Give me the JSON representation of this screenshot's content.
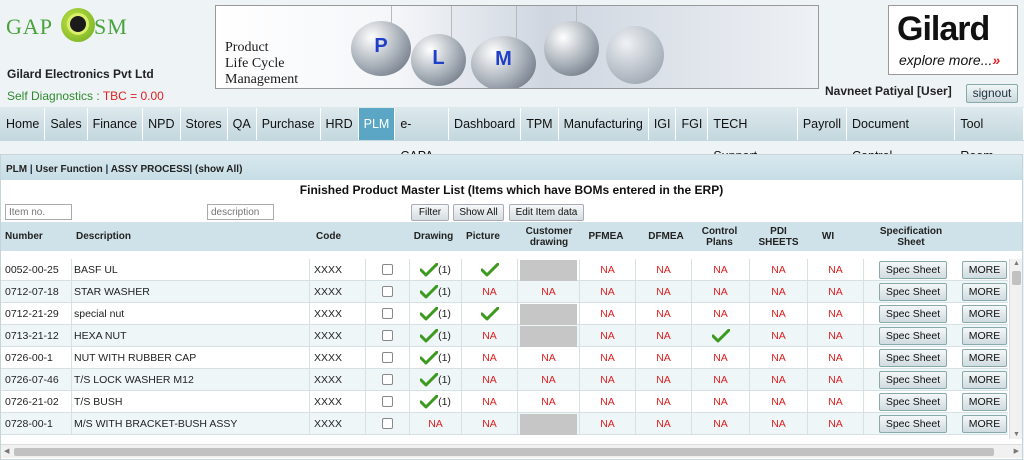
{
  "header": {
    "logo_left_1": "GAP",
    "logo_left_2": "SM",
    "company": "Gilard Electronics Pvt Ltd",
    "self_diag_label": "Self Diagnostics : ",
    "self_diag_value": "TBC = 0.00",
    "banner_text": [
      "Product",
      "Life Cycle",
      "Management"
    ],
    "banner_letters": [
      "P",
      "L",
      "M"
    ],
    "brand": "Gilard",
    "brand_tagline": "explore more...",
    "brand_arrow": "»",
    "user": "Navneet Patiyal [User]",
    "signout_label": "signout"
  },
  "nav": {
    "items": [
      "Home",
      "Sales",
      "Finance",
      "NPD",
      "Stores",
      "QA",
      "Purchase",
      "HRD",
      "PLM",
      "e-CAPA",
      "Dashboard",
      "TPM",
      "Manufacturing",
      "IGI",
      "FGI",
      "TECH Support",
      "Payroll",
      "Document Control",
      "Tool Room"
    ],
    "active": "PLM"
  },
  "breadcrumb": [
    "PLM",
    "User Function",
    "ASSY PROCESS",
    "(show All)"
  ],
  "page_title": "Finished Product Master List (Items which have BOMs entered in the ERP)",
  "filters": {
    "item_placeholder": "Item no.",
    "desc_placeholder": "description",
    "filter_label": "Filter",
    "show_all_label": "Show All",
    "edit_label": "Edit Item data"
  },
  "columns": [
    "Number",
    "Description",
    "Code",
    "",
    "Drawing",
    "Picture",
    "Customer drawing",
    "PFMEA",
    "DFMEA",
    "Control Plans",
    "PDI SHEETS",
    "WI",
    "Specification Sheet"
  ],
  "rows": [
    {
      "number": "0052-00-25",
      "description": "BASF UL",
      "code": "XXXX",
      "drawing": "(1)",
      "picture": "tick",
      "customer": "gray",
      "pfmea": "NA",
      "dfmea": "NA",
      "control": "NA",
      "pdi": "NA",
      "wi": "NA"
    },
    {
      "number": "0712-07-18",
      "description": "STAR WASHER",
      "code": "XXXX",
      "drawing": "(1)",
      "picture": "NA",
      "customer": "NA",
      "pfmea": "NA",
      "dfmea": "NA",
      "control": "NA",
      "pdi": "NA",
      "wi": "NA"
    },
    {
      "number": "0712-21-29",
      "description": "special nut",
      "code": "XXXX",
      "drawing": "(1)",
      "picture": "tick",
      "customer": "gray",
      "pfmea": "NA",
      "dfmea": "NA",
      "control": "NA",
      "pdi": "NA",
      "wi": "NA"
    },
    {
      "number": "0713-21-12",
      "description": "HEXA NUT",
      "code": "XXXX",
      "drawing": "(1)",
      "picture": "NA",
      "customer": "gray",
      "pfmea": "NA",
      "dfmea": "NA",
      "control": "tick",
      "pdi": "NA",
      "wi": "NA"
    },
    {
      "number": "0726-00-1",
      "description": "NUT WITH RUBBER CAP",
      "code": "XXXX",
      "drawing": "(1)",
      "picture": "NA",
      "customer": "NA",
      "pfmea": "NA",
      "dfmea": "NA",
      "control": "NA",
      "pdi": "NA",
      "wi": "NA"
    },
    {
      "number": "0726-07-46",
      "description": "T/S LOCK WASHER M12",
      "code": "XXXX",
      "drawing": "(1)",
      "picture": "NA",
      "customer": "NA",
      "pfmea": "NA",
      "dfmea": "NA",
      "control": "NA",
      "pdi": "NA",
      "wi": "NA"
    },
    {
      "number": "0726-21-02",
      "description": "T/S BUSH",
      "code": "XXXX",
      "drawing": "(1)",
      "picture": "NA",
      "customer": "NA",
      "pfmea": "NA",
      "dfmea": "NA",
      "control": "NA",
      "pdi": "NA",
      "wi": "NA"
    },
    {
      "number": "0728-00-1",
      "description": "M/S WITH BRACKET-BUSH ASSY",
      "code": "XXXX",
      "drawing": "NA",
      "picture": "NA",
      "customer": "gray",
      "pfmea": "NA",
      "dfmea": "NA",
      "control": "NA",
      "pdi": "NA",
      "wi": "NA"
    }
  ],
  "spec_label": "Spec Sheet",
  "more_label": "MORE",
  "colors": {
    "accent": "#5ba6c4",
    "na": "#e02020",
    "tick": "#3c9a1e",
    "header_bg": "#cfe2e9"
  },
  "icons": {
    "tick": "check-mark-icon"
  }
}
